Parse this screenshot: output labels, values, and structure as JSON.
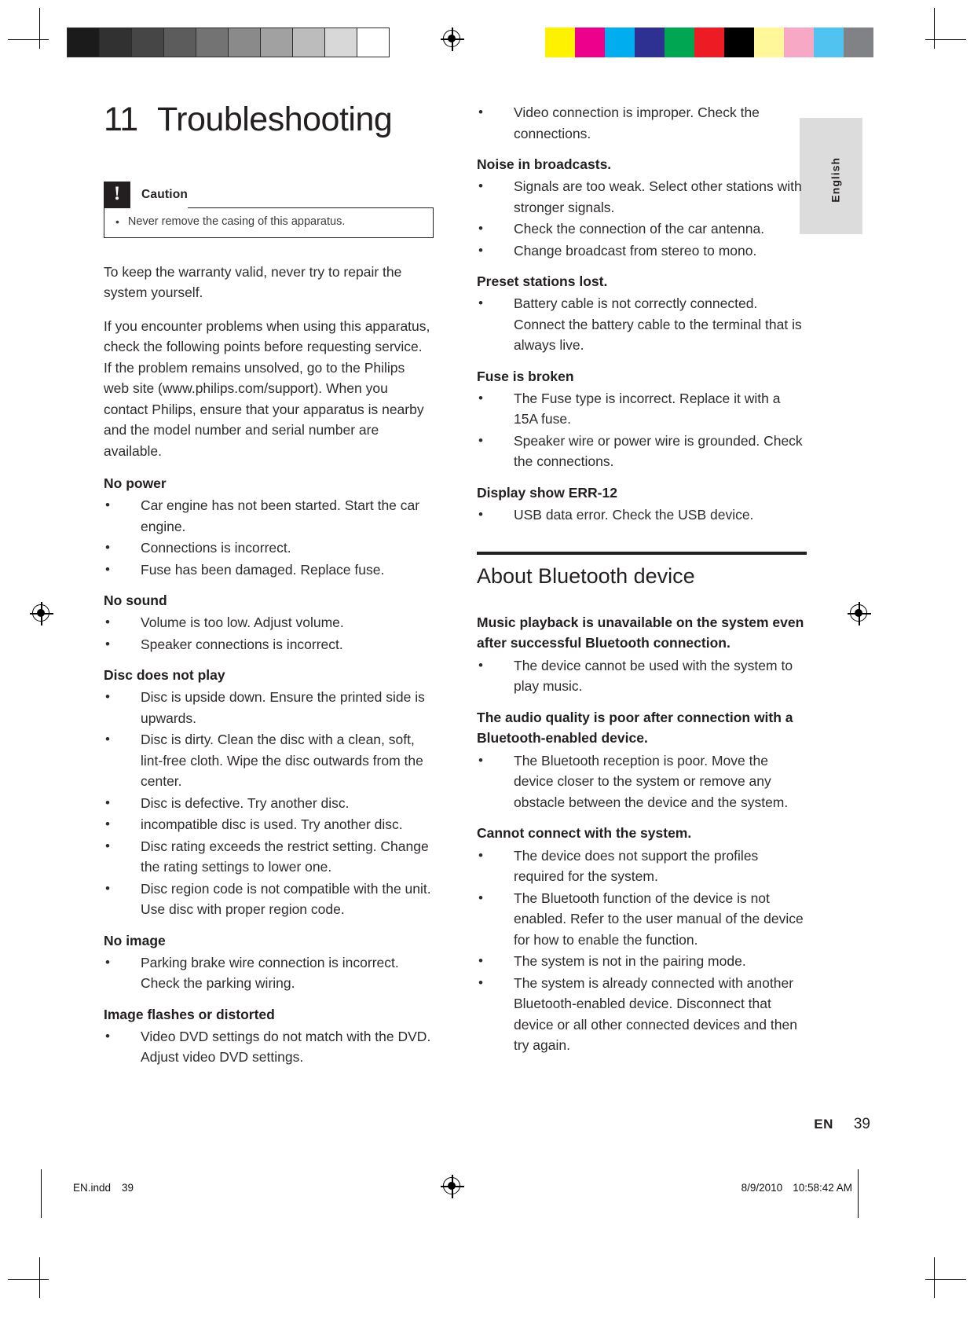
{
  "document": {
    "chapter_number": "11",
    "chapter_title": "Troubleshooting",
    "side_tab": "English",
    "footer": {
      "lang_code": "EN",
      "page_number": "39",
      "slug_file": "EN.indd",
      "slug_page": "39",
      "slug_date": "8/9/2010",
      "slug_time": "10:58:42 AM"
    }
  },
  "caution": {
    "title": "Caution",
    "items": [
      "Never remove the casing of this apparatus."
    ]
  },
  "intro": {
    "p1": "To keep the warranty valid, never try to repair the system yourself.",
    "p2": "If you encounter problems when using this apparatus, check the following points before requesting service. If the problem remains unsolved, go to the Philips web site (www.philips.com/support). When you contact Philips, ensure that your apparatus is nearby and the model number and serial number are available."
  },
  "left_column": {
    "sections": [
      {
        "heading": "No power",
        "items": [
          "Car engine has not been started. Start the car engine.",
          "Connections is incorrect.",
          "Fuse has been damaged. Replace fuse."
        ]
      },
      {
        "heading": "No sound",
        "items": [
          "Volume is too low. Adjust volume.",
          "Speaker connections is incorrect."
        ]
      },
      {
        "heading": "Disc does not play",
        "items": [
          "Disc is upside down. Ensure the printed side is upwards.",
          "Disc is dirty. Clean the disc with a clean, soft, lint-free cloth. Wipe the disc outwards from the center.",
          "Disc is defective. Try another disc.",
          "incompatible disc is used. Try another disc.",
          "Disc rating exceeds the restrict setting. Change the rating settings to lower one.",
          "Disc region code is not compatible with the unit. Use disc with proper region code."
        ]
      },
      {
        "heading": "No image",
        "items": [
          "Parking brake wire connection is incorrect. Check the parking wiring."
        ]
      },
      {
        "heading": "Image flashes or distorted",
        "items": [
          "Video DVD settings do not match with the DVD. Adjust video DVD settings."
        ]
      }
    ]
  },
  "right_column": {
    "continued_items": [
      "Video connection is improper. Check the connections."
    ],
    "sections": [
      {
        "heading": "Noise in broadcasts.",
        "items": [
          "Signals are too weak. Select other stations with stronger signals.",
          "Check the connection of the car antenna.",
          "Change broadcast from stereo to mono."
        ]
      },
      {
        "heading": "Preset stations lost.",
        "items": [
          "Battery cable is not correctly connected. Connect the battery cable to the terminal that is always live."
        ]
      },
      {
        "heading": "Fuse is broken",
        "items": [
          "The Fuse type is incorrect. Replace it with a 15A fuse.",
          "Speaker wire or power wire is grounded. Check the connections."
        ]
      },
      {
        "heading": "Display show ERR-12",
        "items": [
          "USB data error. Check the USB device."
        ]
      }
    ],
    "bluetooth": {
      "title": "About Bluetooth device",
      "sections": [
        {
          "heading": "Music playback is unavailable on the system even after successful Bluetooth connection.",
          "items": [
            "The device cannot be used with the system to play music."
          ]
        },
        {
          "heading": "The audio quality is poor after connection with a Bluetooth-enabled device.",
          "items": [
            "The Bluetooth reception is poor. Move the device closer to the system or remove any obstacle between the device and the system."
          ]
        },
        {
          "heading": "Cannot connect with the system.",
          "items": [
            "The device does not support the profiles required for the system.",
            "The Bluetooth function of the device is not enabled. Refer to the user manual of the device for how to enable the function.",
            "The system is not in the pairing mode.",
            "The system is already connected with another Bluetooth-enabled device. Disconnect that device or all other connected devices and then try again."
          ]
        }
      ]
    }
  },
  "print_marks": {
    "bullet_glyph": "•",
    "grey_bar": [
      "#1b1b1b",
      "#313131",
      "#464646",
      "#5c5c5c",
      "#737373",
      "#8a8a8a",
      "#a1a1a1",
      "#bcbcbc",
      "#d8d8d8",
      "#ffffff"
    ],
    "color_bar": [
      "#fff200",
      "#ec008c",
      "#00aeef",
      "#2e3192",
      "#00a651",
      "#ed1c24",
      "#000000",
      "#fff799",
      "#f7a8c4",
      "#50c3f0",
      "#808285"
    ]
  }
}
